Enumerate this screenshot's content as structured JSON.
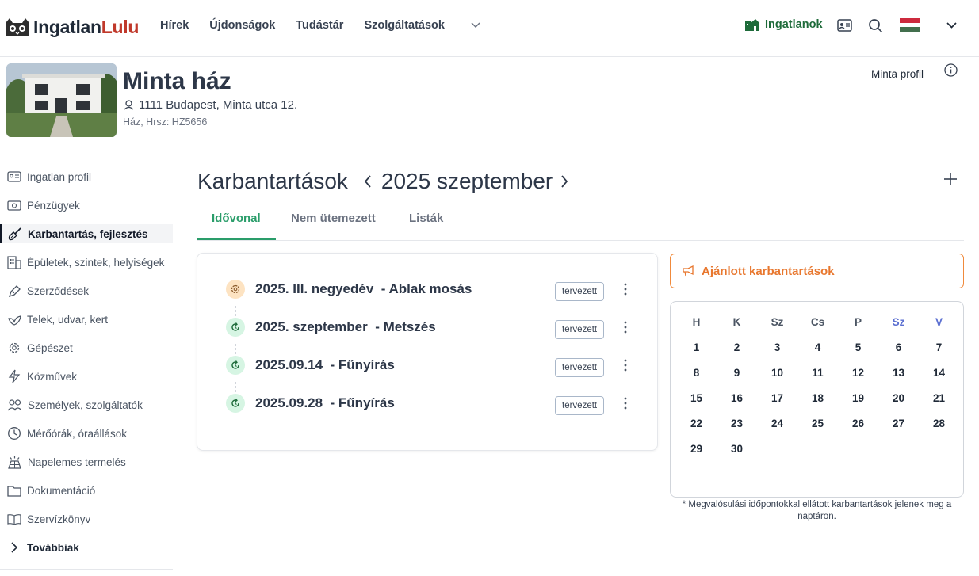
{
  "header": {
    "brand_part1": "Ingatlan",
    "brand_part2": "Lulu",
    "nav": [
      "Hírek",
      "Újdonságok",
      "Tudástár",
      "Szolgáltatások"
    ],
    "properties_label": "Ingatlanok"
  },
  "property": {
    "title": "Minta ház",
    "address": "1111 Budapest, Minta utca 12.",
    "subtitle": "Ház, Hrsz: HZ5656",
    "profile_label": "Minta profil"
  },
  "sidebar": {
    "items": [
      {
        "label": "Ingatlan profil",
        "icon": "id-card-icon"
      },
      {
        "label": "Pénzügyek",
        "icon": "money-icon"
      },
      {
        "label": "Karbantartás, fejlesztés",
        "icon": "paintbrush-icon",
        "active": true
      },
      {
        "label": "Épületek, szintek, helyiségek",
        "icon": "building-icon"
      },
      {
        "label": "Szerződések",
        "icon": "pen-icon"
      },
      {
        "label": "Telek, udvar, kert",
        "icon": "leaf-icon"
      },
      {
        "label": "Gépészet",
        "icon": "gear-icon"
      },
      {
        "label": "Közművek",
        "icon": "bolt-icon"
      },
      {
        "label": "Személyek, szolgáltatók",
        "icon": "people-icon"
      },
      {
        "label": "Mérőórák, óraállások",
        "icon": "clock-icon"
      },
      {
        "label": "Napelemes termelés",
        "icon": "solar-panel-icon"
      },
      {
        "label": "Dokumentáció",
        "icon": "folder-icon"
      },
      {
        "label": "Szervízkönyv",
        "icon": "book-icon"
      }
    ],
    "more_label": "Továbbiak"
  },
  "main": {
    "title": "Karbantartások",
    "period": "2025 szeptember",
    "tabs": [
      {
        "label": "Idővonal",
        "active": true
      },
      {
        "label": "Nem ütemezett"
      },
      {
        "label": "Listák"
      }
    ]
  },
  "timeline": [
    {
      "text": "2025. III. negyedév  - Ablak mosás",
      "badge": "tervezett",
      "icon": "gear-icon"
    },
    {
      "text": "2025. szeptember  - Metszés",
      "badge": "tervezett",
      "icon": "recurring-icon"
    },
    {
      "text": "2025.09.14  - Fűnyírás",
      "badge": "tervezett",
      "icon": "recurring-icon"
    },
    {
      "text": "2025.09.28  - Fűnyírás",
      "badge": "tervezett",
      "icon": "recurring-icon"
    }
  ],
  "recommended_label": "Ajánlott karbantartások",
  "calendar": {
    "weekdays": [
      "H",
      "K",
      "Sz",
      "Cs",
      "P",
      "Sz",
      "V"
    ],
    "days": [
      "1",
      "2",
      "3",
      "4",
      "5",
      "6",
      "7",
      "8",
      "9",
      "10",
      "11",
      "12",
      "13",
      "14",
      "15",
      "16",
      "17",
      "18",
      "19",
      "20",
      "21",
      "22",
      "23",
      "24",
      "25",
      "26",
      "27",
      "28",
      "29",
      "30"
    ],
    "note": "* Megvalósulási időpontokkal ellátott karbantartások jelenek meg a naptáron."
  },
  "colors": {
    "accent_green": "#2a9d6a",
    "brand_red": "#c0392b",
    "orange": "#e8772e",
    "weekend_blue": "#5b6fd1"
  }
}
